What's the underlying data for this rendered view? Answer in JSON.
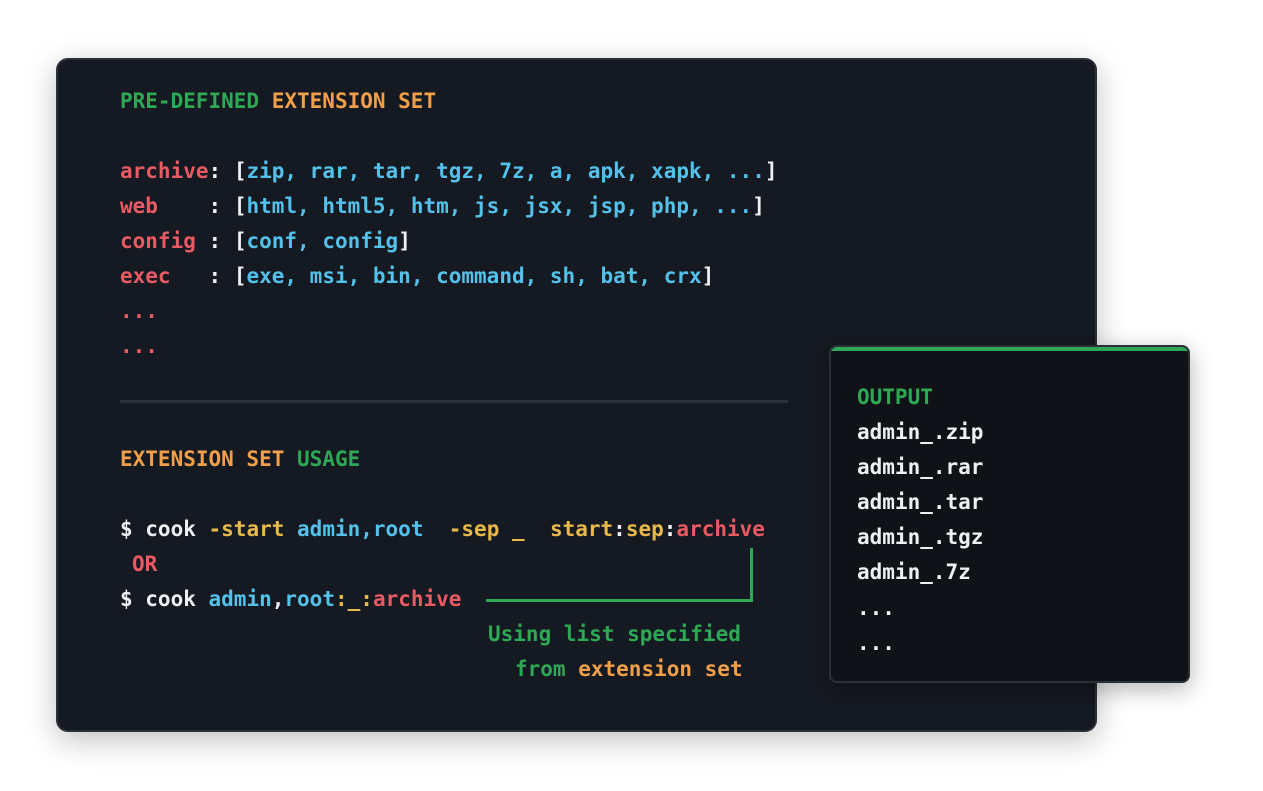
{
  "definition_section": {
    "title_part1": "PRE-DEFINED",
    "title_part2": "EXTENSION SET",
    "entries": [
      {
        "key": "archive",
        "sep": ": ",
        "open": "[",
        "values": "zip, rar, tar, tgz, 7z, a, apk, xapk, ...",
        "close": "]"
      },
      {
        "key": "web    ",
        "sep": ": ",
        "open": "[",
        "values": "html, html5, htm, js, jsx, jsp, php, ...",
        "close": "]"
      },
      {
        "key": "config ",
        "sep": ": ",
        "open": "[",
        "values": "conf, config",
        "close": "]"
      },
      {
        "key": "exec   ",
        "sep": ": ",
        "open": "[",
        "values": "exe, msi, bin, command, sh, bat, crx",
        "close": "]"
      }
    ],
    "ellipsis": [
      "...",
      "..."
    ]
  },
  "usage_section": {
    "title_part1": "EXTENSION SET",
    "title_part2": "USAGE",
    "command1": {
      "prompt": "$ cook ",
      "flag_start": "-start",
      "arg_words": "admin,root",
      "flag_sep": "-sep",
      "sep_val": "_",
      "pattern_start": "start",
      "colon1": ":",
      "pattern_sep": "sep",
      "colon2": ":",
      "pattern_set": "archive"
    },
    "or_label": "OR",
    "command2": {
      "prompt": "$ cook ",
      "word1": "admin",
      "comma": ",",
      "word2": "root",
      "colon1": ":",
      "sep": "_",
      "colon2": ":",
      "set": "archive"
    },
    "annotation": {
      "line1": "Using list specified",
      "line2_part1": "from",
      "line2_part2": "extension set"
    }
  },
  "output_panel": {
    "title": "OUTPUT",
    "lines": [
      "admin_.zip",
      "admin_.rar",
      "admin_.tar",
      "admin_.tgz",
      "admin_.7z",
      "...",
      "..."
    ]
  },
  "colors": {
    "background": "#151921",
    "green": "#2ea855",
    "orange": "#f0a04b",
    "red": "#e95b64",
    "blue": "#53c1ea",
    "white": "#eef0f3"
  }
}
